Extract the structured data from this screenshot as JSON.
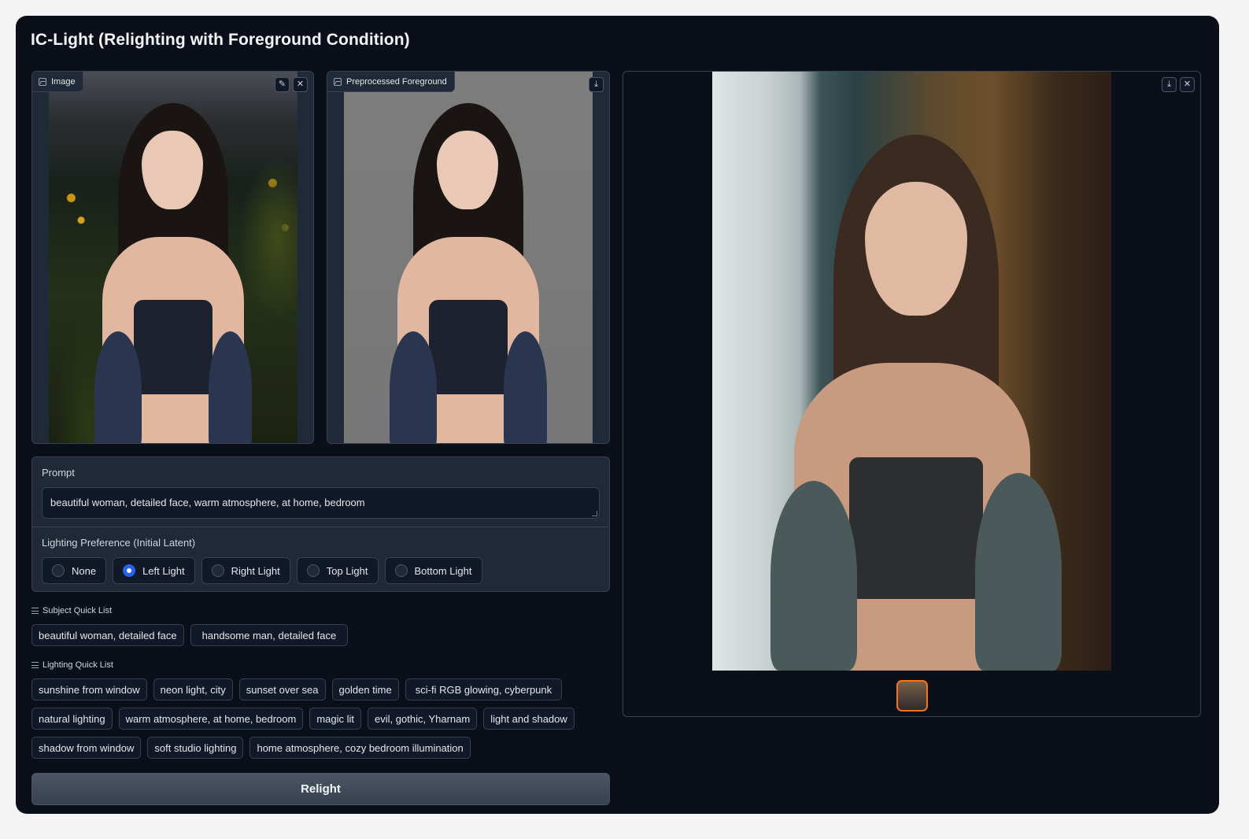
{
  "app": {
    "title": "IC-Light (Relighting with Foreground Condition)"
  },
  "input_image": {
    "label": "Image",
    "label_icon": "image-icon",
    "tools": [
      "edit-icon",
      "close-icon"
    ]
  },
  "preprocessed": {
    "label": "Preprocessed Foreground",
    "label_icon": "image-icon",
    "tools": [
      "download-icon"
    ]
  },
  "prompt": {
    "label": "Prompt",
    "value": "beautiful woman, detailed face, warm atmosphere, at home, bedroom"
  },
  "lighting": {
    "label": "Lighting Preference (Initial Latent)",
    "options": [
      "None",
      "Left Light",
      "Right Light",
      "Top Light",
      "Bottom Light"
    ],
    "selected": "Left Light"
  },
  "subject_quick_list": {
    "label": "Subject Quick List",
    "items": [
      "beautiful woman, detailed face",
      "handsome man, detailed face"
    ]
  },
  "lighting_quick_list": {
    "label": "Lighting Quick List",
    "items": [
      "sunshine from window",
      "neon light, city",
      "sunset over sea",
      "golden time",
      "sci-fi RGB glowing, cyberpunk",
      "natural lighting",
      "warm atmosphere, at home, bedroom",
      "magic lit",
      "evil, gothic, Yharnam",
      "light and shadow",
      "shadow from window",
      "soft studio lighting",
      "home atmosphere, cozy bedroom illumination"
    ]
  },
  "relight_button": {
    "label": "Relight"
  },
  "output_gallery": {
    "tools": [
      "download-icon",
      "close-icon"
    ],
    "thumbnails": 1,
    "accent": "#f97316"
  },
  "colors": {
    "background": "#0b0f19",
    "panel": "#1f2937",
    "radio_selected": "#2563eb"
  }
}
